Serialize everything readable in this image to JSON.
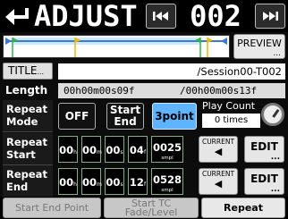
{
  "header": {
    "title": "ADJUST",
    "prev_icon": "skip-back-icon",
    "next_icon": "skip-forward-icon",
    "back_icon": "return-arrow-icon",
    "track_number": "002"
  },
  "timeline": {
    "preview_label": "PREVIEW",
    "preview_more": "...",
    "colors": {
      "blue": "#3a7bd5",
      "yellow": "#f2b705",
      "green": "#2fb34a",
      "fill": "#bfe6ff"
    }
  },
  "title_row": {
    "button_label": "TITLE",
    "button_more": "...",
    "value": "/Session00-T002"
  },
  "length_row": {
    "label": "Length",
    "value": "00h00m00s09f",
    "total": "/00h00m00s13f"
  },
  "repeat_mode": {
    "label_line1": "Repeat",
    "label_line2": "Mode",
    "options": [
      "OFF",
      "Start End",
      "3point"
    ],
    "selected": "3point",
    "play_count_label": "Play Count",
    "play_count_value": "0 times"
  },
  "repeat_start": {
    "label_line1": "Repeat",
    "label_line2": "Start",
    "hours": "00",
    "minutes": "00",
    "seconds": "00",
    "frames": "04",
    "samples": "0025",
    "units": {
      "h": "h",
      "m": "m",
      "s": "s",
      "f": "f",
      "smpl": "smpl"
    },
    "current_label": "CURRENT",
    "edit_label": "EDIT",
    "edit_more": "..."
  },
  "repeat_end": {
    "label_line1": "Repeat",
    "label_line2": "End",
    "hours": "00",
    "minutes": "00",
    "seconds": "00",
    "frames": "12",
    "samples": "0528",
    "units": {
      "h": "h",
      "m": "m",
      "s": "s",
      "f": "f",
      "smpl": "smpl"
    },
    "current_label": "CURRENT",
    "edit_label": "EDIT",
    "edit_more": "..."
  },
  "bottom": {
    "btn1": "Start End Point",
    "btn2_line1": "Start TC",
    "btn2_line2": "Fade/Level",
    "btn3": "Repeat"
  }
}
